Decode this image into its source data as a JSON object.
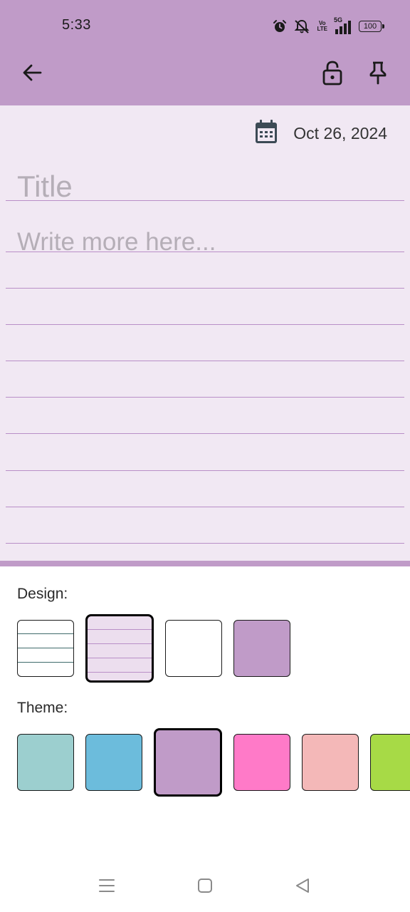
{
  "status_bar": {
    "time": "5:33",
    "network": "5G",
    "volte_line1": "Vo",
    "volte_line2": "LTE",
    "battery": "100",
    "icons": [
      "alarm-icon",
      "mute-icon",
      "volte-icon",
      "signal-icon",
      "battery-icon"
    ]
  },
  "app_bar": {
    "back_icon": "arrow-back-icon",
    "lock_icon": "lock-open-icon",
    "pin_icon": "pin-icon"
  },
  "note": {
    "date": "Oct 26, 2024",
    "title_placeholder": "Title",
    "body_placeholder": "Write more here..."
  },
  "design": {
    "label": "Design:",
    "options": [
      {
        "name": "lined-white",
        "selected": false
      },
      {
        "name": "lined-theme",
        "selected": true
      },
      {
        "name": "plain-white",
        "selected": false
      },
      {
        "name": "solid-theme",
        "selected": false
      }
    ]
  },
  "theme": {
    "label": "Theme:",
    "colors": [
      {
        "color": "#9ccfcf",
        "selected": false
      },
      {
        "color": "#6cbcdc",
        "selected": false
      },
      {
        "color": "#c09bc8",
        "selected": true
      },
      {
        "color": "#ff7ac8",
        "selected": false
      },
      {
        "color": "#f4b8b8",
        "selected": false
      },
      {
        "color": "#a7da46",
        "selected": false
      }
    ]
  },
  "colors": {
    "accent": "#c09bc8",
    "paper": "#f1e8f3",
    "rule": "#b98fc7"
  },
  "nav_bar": {
    "icons": [
      "menu-icon",
      "home-icon",
      "back-triangle-icon"
    ]
  }
}
